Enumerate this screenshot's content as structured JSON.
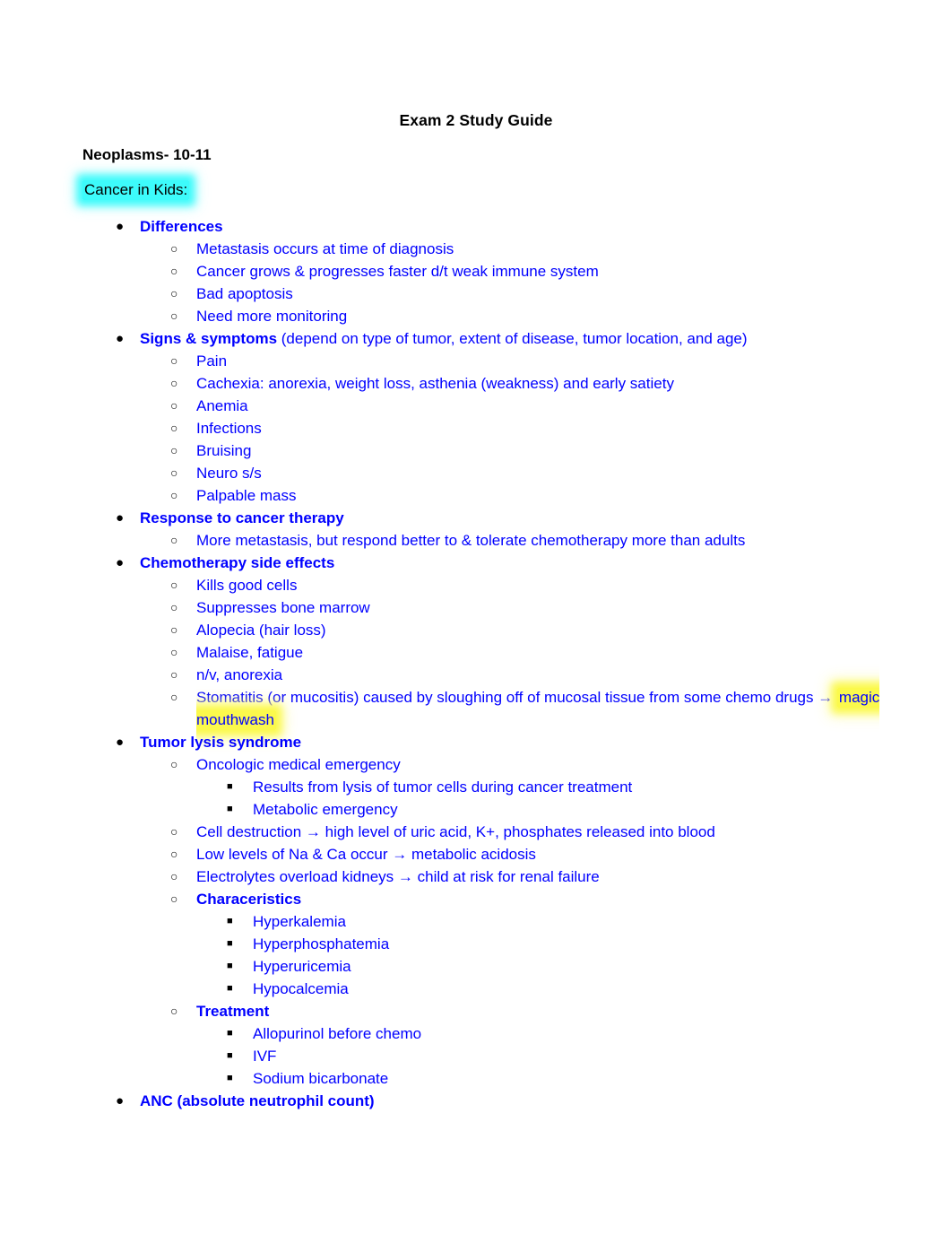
{
  "document": {
    "title": "Exam 2 Study Guide",
    "section_heading": "Neoplasms- 10-11",
    "subheading": "Cancer in Kids:",
    "subheading_highlight_color": "#3dfbfb",
    "body_text_color": "#0000ff",
    "heading_text_color": "#000000"
  },
  "bullets": {
    "level1_glyph": "●",
    "level2_glyph": "○",
    "level3_glyph": "■"
  },
  "outline": {
    "differences": {
      "label": "Differences",
      "items": [
        "Metastasis occurs at time of diagnosis",
        "Cancer grows & progresses faster d/t weak immune system",
        "Bad apoptosis",
        "Need more monitoring"
      ]
    },
    "signs_symptoms": {
      "label": "Signs & symptoms",
      "label_suffix": " (depend on type of tumor, extent of disease, tumor location, and age)",
      "items": [
        "Pain",
        "Cachexia: anorexia, weight loss, asthenia (weakness) and early satiety",
        "Anemia",
        "Infections",
        "Bruising",
        "Neuro s/s",
        "Palpable mass"
      ]
    },
    "response_to_cancer_therapy": {
      "label": "Response to cancer therapy",
      "items": [
        "More metastasis, but respond better to & tolerate chemotherapy more than adults"
      ]
    },
    "chemotherapy_side_effects": {
      "label": "Chemotherapy side effects",
      "items": [
        "Kills good cells",
        "Suppresses bone marrow",
        "Alopecia (hair loss)",
        "Malaise, fatigue",
        "n/v, anorexia"
      ],
      "stomatitis_prefix": "Stomatitis (or mucositis) caused by sloughing off of mucosal tissue from some chemo drugs → ",
      "stomatitis_highlight": "magic mouthwash",
      "stomatitis_highlight_color": "#fbf94c"
    },
    "tumor_lysis_syndrome": {
      "label": "Tumor lysis syndrome",
      "oncologic_emergency": {
        "label": "Oncologic medical emergency",
        "items": [
          "Results from lysis of tumor cells during cancer treatment",
          "Metabolic emergency"
        ]
      },
      "items": [
        "Cell destruction → high level of uric acid, K+, phosphates released into blood",
        "Low levels of Na & Ca occur → metabolic acidosis",
        "Electrolytes overload kidneys → child at risk for renal failure"
      ],
      "characteristics": {
        "label": "Characeristics",
        "items": [
          "Hyperkalemia",
          "Hyperphosphatemia",
          "Hyperuricemia",
          "Hypocalcemia"
        ]
      },
      "treatment": {
        "label": "Treatment",
        "items": [
          "Allopurinol before chemo",
          "IVF",
          "Sodium bicarbonate"
        ]
      }
    },
    "anc": {
      "label": "ANC (absolute neutrophil count)"
    }
  }
}
